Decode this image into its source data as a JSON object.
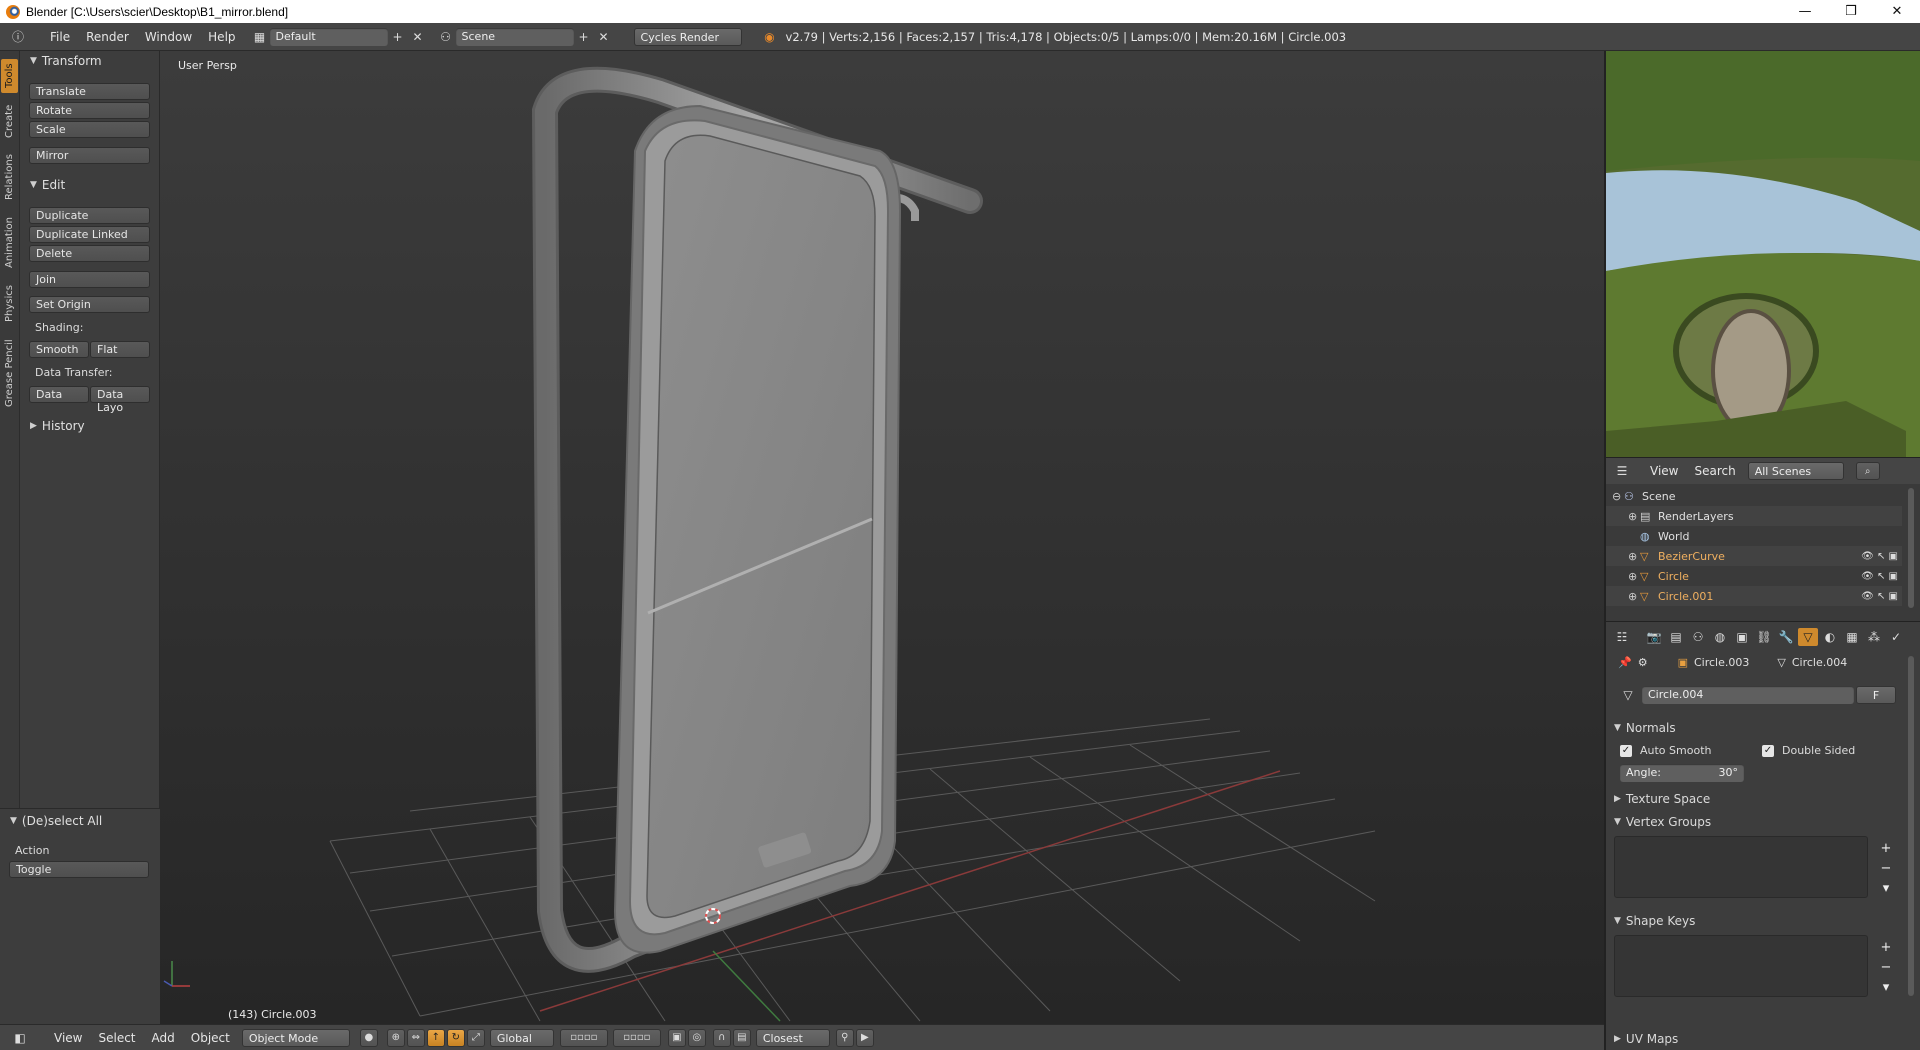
{
  "window": {
    "title": "Blender [C:\\Users\\scier\\Desktop\\B1_mirror.blend]",
    "minimize": "—",
    "maximize": "❒",
    "close": "✕"
  },
  "info": {
    "menus": [
      "File",
      "Render",
      "Window",
      "Help"
    ],
    "screen_layout": "Default",
    "scene": "Scene",
    "render_engine": "Cycles Render",
    "stats": "v2.79 | Verts:2,156 | Faces:2,157 | Tris:4,178 | Objects:0/5 | Lamps:0/0 | Mem:20.16M | Circle.003"
  },
  "tool_tabs": [
    "Tools",
    "Create",
    "Relations",
    "Animation",
    "Physics",
    "Grease Pencil"
  ],
  "toolshelf": {
    "transform_title": "Transform",
    "translate": "Translate",
    "rotate": "Rotate",
    "scale": "Scale",
    "mirror": "Mirror",
    "edit_title": "Edit",
    "duplicate": "Duplicate",
    "duplicate_linked": "Duplicate Linked",
    "delete": "Delete",
    "join": "Join",
    "set_origin": "Set Origin",
    "shading_label": "Shading:",
    "smooth": "Smooth",
    "flat": "Flat",
    "data_transfer_label": "Data Transfer:",
    "data": "Data",
    "data_layout": "Data Layo",
    "history_title": "History"
  },
  "operator": {
    "title": "(De)select All",
    "action_label": "Action",
    "action_value": "Toggle"
  },
  "viewport": {
    "view_name": "User Persp",
    "object_info": "(143) Circle.003"
  },
  "bottombar": {
    "menus": [
      "View",
      "Select",
      "Add",
      "Object"
    ],
    "mode": "Object Mode",
    "orientation": "Global",
    "snap_target": "Closest"
  },
  "outliner": {
    "menus": [
      "View",
      "Search"
    ],
    "display_mode": "All Scenes",
    "items": [
      {
        "label": "Scene",
        "icon": "scene-icon"
      },
      {
        "label": "RenderLayers",
        "icon": "render-layers-icon"
      },
      {
        "label": "World",
        "icon": "world-icon"
      },
      {
        "label": "BezierCurve",
        "icon": "curve-icon"
      },
      {
        "label": "Circle",
        "icon": "mesh-icon"
      },
      {
        "label": "Circle.001",
        "icon": "mesh-icon"
      }
    ]
  },
  "properties": {
    "object_name": "Circle.003",
    "mesh_name": "Circle.004",
    "datablock_name": "Circle.004",
    "fake_user": "F",
    "normals_title": "Normals",
    "auto_smooth": "Auto Smooth",
    "double_sided": "Double Sided",
    "angle_label": "Angle:",
    "angle_value": "30°",
    "texture_space_title": "Texture Space",
    "vertex_groups_title": "Vertex Groups",
    "shape_keys_title": "Shape Keys",
    "uv_maps_title": "UV Maps"
  },
  "colors": {
    "accent": "#cf8a2d",
    "viewport_bg": "#2f2f2f",
    "panel_bg": "#3d3d3d"
  }
}
